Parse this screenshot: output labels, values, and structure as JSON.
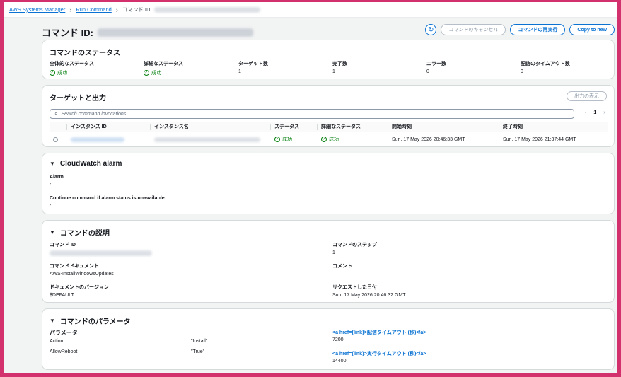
{
  "breadcrumb": {
    "root": "AWS Systems Manager",
    "section": "Run Command",
    "current_prefix": "コマンド ID:"
  },
  "header": {
    "title": "コマンド ID:",
    "cancel_label": "コマンドのキャンセル",
    "rerun_label": "コマンドの再実行",
    "copy_label": "Copy to new"
  },
  "status": {
    "title": "コマンドのステータス",
    "items": [
      {
        "label": "全体的なステータス",
        "value": "成功",
        "ok": true
      },
      {
        "label": "詳細なステータス",
        "value": "成功",
        "ok": true
      },
      {
        "label": "ターゲット数",
        "value": "1"
      },
      {
        "label": "完了数",
        "value": "1"
      },
      {
        "label": "エラー数",
        "value": "0"
      },
      {
        "label": "配信のタイムアウト数",
        "value": "0"
      }
    ]
  },
  "targets": {
    "title": "ターゲットと出力",
    "show_output_label": "出力の表示",
    "search_placeholder": "Search command invocations",
    "page": "1",
    "columns": [
      "インスタンス ID",
      "インスタンス名",
      "ステータス",
      "詳細なステータス",
      "開始時刻",
      "終了時刻"
    ],
    "row": {
      "status": "成功",
      "detailed_status": "成功",
      "start": "Sun, 17 May 2026 20:46:33 GMT",
      "end": "Sun, 17 May 2026 21:37:44 GMT"
    }
  },
  "cloudwatch": {
    "title": "CloudWatch alarm",
    "alarm_label": "Alarm",
    "alarm_value": "-",
    "continue_label": "Continue command if alarm status is unavailable",
    "continue_value": "-"
  },
  "description": {
    "title": "コマンドの説明",
    "command_id_label": "コマンド ID",
    "document_label": "コマンドドキュメント",
    "document_value": "AWS-InstallWindowsUpdates",
    "version_label": "ドキュメントのバージョン",
    "version_value": "$DEFAULT",
    "steps_label": "コマンドのステップ",
    "steps_value": "1",
    "comment_label": "コメント",
    "requested_label": "リクエストした日付",
    "requested_value": "Sun, 17 May 2026 20:46:32 GMT"
  },
  "parameters": {
    "title": "コマンドのパラメータ",
    "params_label": "パラメータ",
    "items": [
      {
        "name": "Action",
        "value": "\"Install\""
      },
      {
        "name": "AllowReboot",
        "value": "\"True\""
      }
    ],
    "delivery_timeout_label": "<a href={link}>配信タイムアウト (秒)</a>",
    "delivery_timeout_value": "7200",
    "execution_timeout_label": "<a href={link}>実行タイムアウト (秒)</a>",
    "execution_timeout_value": "14400"
  },
  "colors": {
    "accent": "#0972d3",
    "success": "#037f0c",
    "frame": "#d3306e"
  }
}
